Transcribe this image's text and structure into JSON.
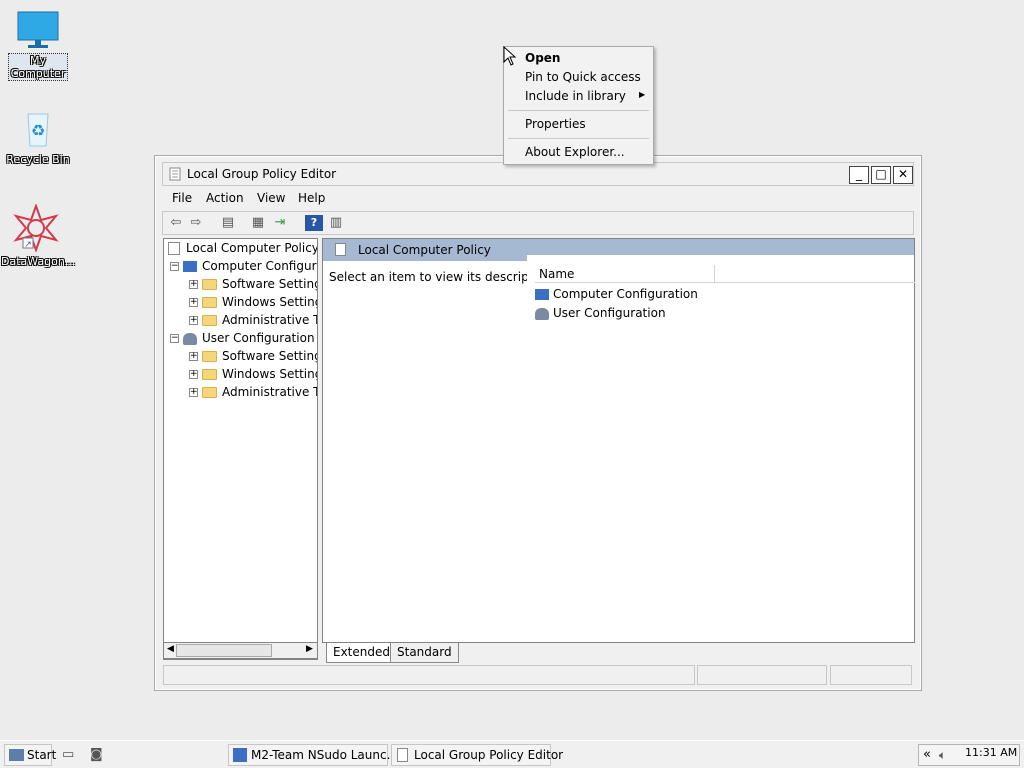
{
  "desktop": {
    "icons": [
      {
        "label": "My Computer"
      },
      {
        "label": "Recycle Bin"
      },
      {
        "label": "DataWagon..."
      }
    ]
  },
  "window": {
    "title": "Local Group Policy Editor",
    "controls": {
      "minimize": "_",
      "maximize": "□",
      "close": "✕"
    },
    "menu": [
      "File",
      "Action",
      "View",
      "Help"
    ],
    "tree": {
      "root": "Local Computer Policy",
      "nodes": [
        "Computer Configura",
        "Software Settings",
        "Windows Setting",
        "Administrative Te",
        "User Configuration",
        "Software Settings",
        "Windows Setting",
        "Administrative Te"
      ]
    },
    "right": {
      "header": "Local Computer Policy",
      "description": "Select an item to view its description.",
      "column_name": "Name",
      "items": [
        "Computer Configuration",
        "User Configuration"
      ]
    },
    "tabs": [
      "Extended",
      "Standard"
    ]
  },
  "context_menu": {
    "items": [
      "Open",
      "Pin to Quick access",
      "Include in library",
      "Properties",
      "About Explorer..."
    ]
  },
  "taskbar": {
    "start": "Start",
    "buttons": [
      "M2-Team NSudo Launc...",
      "Local Group Policy Editor"
    ],
    "clock": "11:31 AM"
  }
}
